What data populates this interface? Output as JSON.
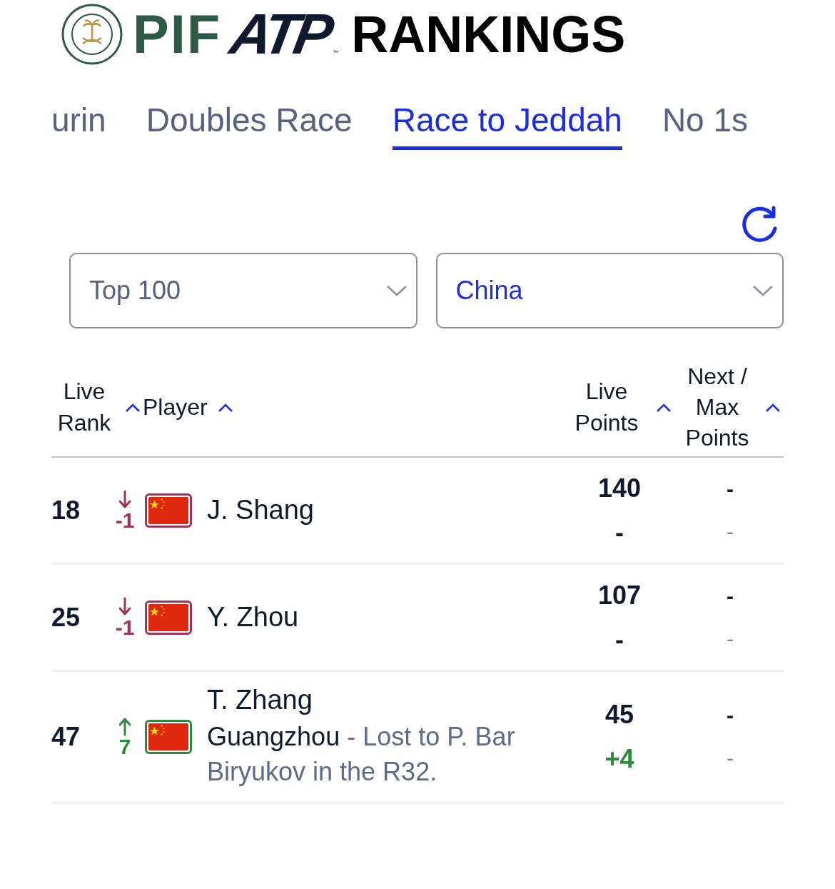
{
  "header": {
    "brand": "PIF",
    "logo": "ATP",
    "trademark": "™",
    "title": "RANKINGS"
  },
  "tabs": [
    {
      "label": "urin",
      "selected": false
    },
    {
      "label": "Doubles Race",
      "selected": false
    },
    {
      "label": "Race to Jeddah",
      "selected": true
    },
    {
      "label": "No 1s",
      "selected": false
    }
  ],
  "filters": [
    {
      "value": "Top 100",
      "active": false
    },
    {
      "value": "China",
      "active": true
    }
  ],
  "columns": [
    {
      "label": "Live Rank"
    },
    {
      "label": "Player"
    },
    {
      "label": "Live Points"
    },
    {
      "label": "Next / Max Points"
    }
  ],
  "rows": [
    {
      "rank": "18",
      "rising": false,
      "movement": "-1",
      "player": "J. Shang",
      "points": "140",
      "points_change": "-",
      "next": "-",
      "max": "-"
    },
    {
      "rank": "25",
      "rising": false,
      "movement": "-1",
      "player": "Y. Zhou",
      "points": "107",
      "points_change": "-",
      "next": "-",
      "max": "-"
    },
    {
      "rank": "47",
      "rising": true,
      "movement": "7",
      "player": "T. Zhang",
      "note": {
        "event": "Guangzhou",
        "text": "- Lost to P. Bar Biryukov in the R32."
      },
      "points": "45",
      "points_change": "+4",
      "next": "-",
      "max": "-"
    }
  ]
}
